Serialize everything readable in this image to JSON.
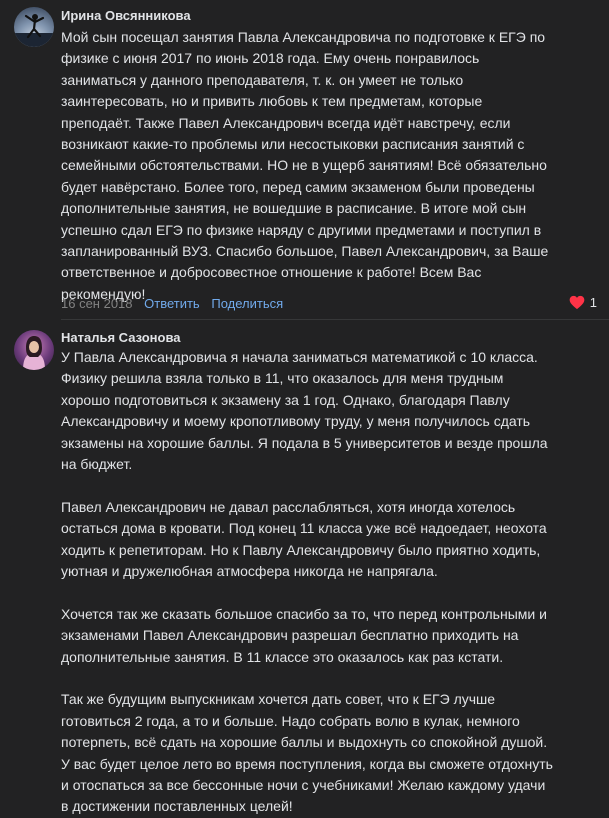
{
  "comments": [
    {
      "author": "Ирина Овсянникова",
      "lines": [
        "Мой сын посещал занятия Павла Александровича по подготовке к ЕГЭ по",
        "физике с июня 2017 по июнь 2018 года. Ему очень понравилось",
        "заниматься у данного преподавателя, т. к. он умеет не только",
        "заинтересовать, но и привить любовь к тем предметам, которые",
        "преподаёт. Также Павел Александрович всегда идёт навстречу, если",
        "возникают какие-то проблемы или несостыковки расписания занятий с",
        "семейными обстоятельствами. НО не в ущерб занятиям! Всё обязательно",
        "будет навёрстано. Более того, перед самим экзаменом были проведены",
        "дополнительные занятия, не вошедшие в расписание. В итоге мой сын",
        "успешно сдал ЕГЭ по физике наряду с другими предметами и поступил в",
        "запланированный ВУЗ. Спасибо большое, Павел Александрович, за Ваше",
        "ответственное и добросовестное отношение к работе! Всем Вас",
        "рекомендую!"
      ],
      "date": "16 сен 2018",
      "reply": "Ответить",
      "share": "Поделиться",
      "likes": "1"
    },
    {
      "author": "Наталья Сазонова",
      "paragraphs": [
        [
          "У Павла Александровича я начала заниматься математикой с 10 класса.",
          "Физику решила взяла только в 11, что оказалось для меня трудным",
          "хорошо подготовиться к экзамену за 1 год. Однако, благодаря Павлу",
          "Александровичу и моему кропотливому труду, у меня получилось сдать",
          "экзамены на хорошие баллы. Я подала в 5 университетов и везде прошла",
          "на бюджет."
        ],
        [
          "Павел Александрович не давал расслабляться, хотя иногда хотелось",
          "остаться дома в кровати. Под конец 11 класса уже всё надоедает, неохота",
          "ходить к репетиторам. Но к Павлу Александровичу было приятно ходить,",
          "уютная и дружелюбная атмосфера никогда не напрягала."
        ],
        [
          "Хочется так же сказать большое спасибо за то, что перед контрольными и",
          "экзаменами Павел Александрович разрешал бесплатно приходить на",
          "дополнительные занятия. В 11 классе это оказалось как раз кстати."
        ],
        [
          "Так же будущим выпускникам хочется дать совет, что к ЕГЭ лучше",
          "готовиться 2 года, а то и больше. Надо собрать волю в кулак, немного",
          "потерпеть, всё сдать на хорошие баллы и выдохнуть со спокойной душой.",
          "У вас будет целое лето во время поступления, когда вы сможете отдохнуть",
          "и отоспаться за все бессонные ночи с учебниками! Желаю каждому удачи",
          "в достижении поставленных целей!"
        ]
      ]
    }
  ],
  "colors": {
    "background": "#222223",
    "text": "#e1e3e6",
    "link": "#71aaeb",
    "muted": "#828282",
    "heart": "#ff3347"
  }
}
